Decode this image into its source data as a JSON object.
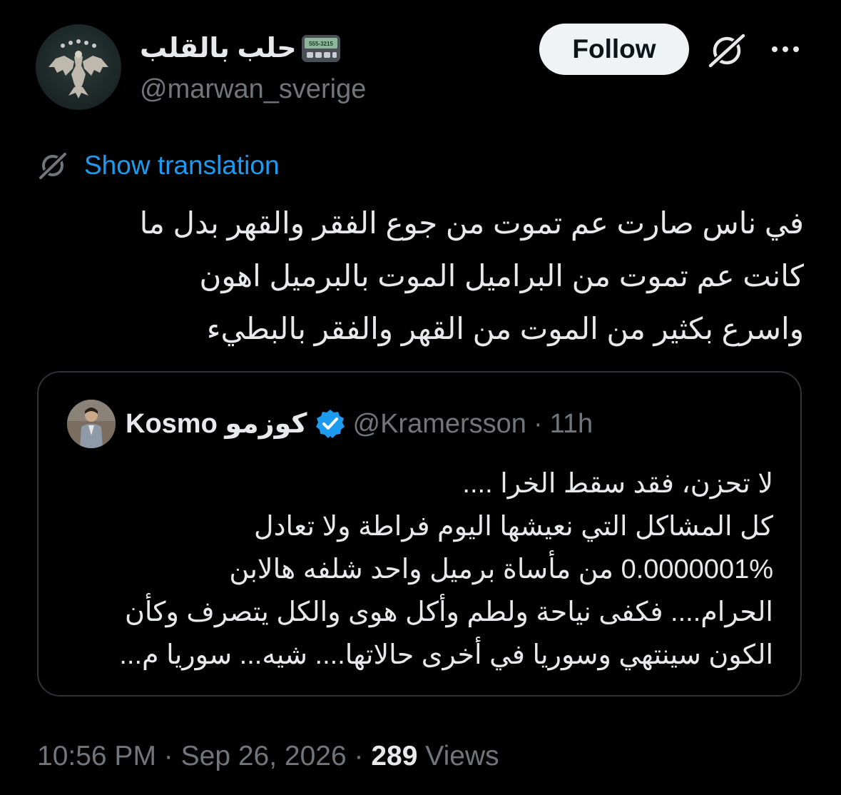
{
  "author": {
    "display_name": "حلب بالقلب",
    "handle": "@marwan_sverige",
    "pager_text": "555-3215"
  },
  "actions": {
    "follow_label": "Follow"
  },
  "translation": {
    "label": "Show translation"
  },
  "tweet": {
    "lines": [
      "في ناس صارت عم تموت من جوع  الفقر والقهر بدل ما",
      "كانت عم تموت من البراميل الموت بالبرميل اهون",
      "واسرع بكثير من الموت من القهر والفقر بالبطيء"
    ]
  },
  "quote": {
    "display_name": "Kosmo كوزمو",
    "handle": "@Kramersson",
    "separator": "·",
    "time": "11h",
    "lines": [
      "لا تحزن، فقد سقط الخرا ....",
      "كل المشاكل التي نعيشها اليوم فراطة ولا تعادل",
      "0.0000001% من مأساة برميل واحد شلفه هالابن",
      "الحرام.... فكفى نياحة ولطم وأكل هوى والكل يتصرف وكأن",
      "الكون سينتهي وسوريا في أخرى حالاتها.... شيه... سوريا م..."
    ]
  },
  "meta": {
    "time": "10:56 PM",
    "separator": "·",
    "date": "Sep 26, 2026",
    "views_count": "289",
    "views_label": "Views"
  },
  "colors": {
    "background": "#000000",
    "text_primary": "#e7e9ea",
    "text_secondary": "#71767b",
    "link": "#1d9bf0",
    "verified": "#1d9bf0",
    "follow_bg": "#eff3f4",
    "border": "#2f3336"
  },
  "icons": {
    "pager": "pager-icon",
    "grok": "grok-icon",
    "more": "more-icon",
    "translate": "translate-icon",
    "verified": "verified-badge-icon"
  }
}
